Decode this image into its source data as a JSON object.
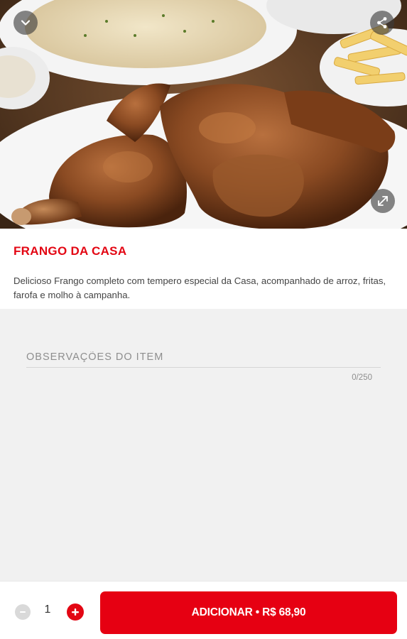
{
  "product": {
    "title": "FRANGO DA CASA",
    "description": "Delicioso Frango completo com tempero especial da Casa, acompanhado de arroz, fritas, farofa e molho à campanha."
  },
  "hero": {
    "back_icon": "chevron-down-icon",
    "share_icon": "share-icon",
    "expand_icon": "expand-icon"
  },
  "observations": {
    "placeholder": "OBSERVAÇÕES DO ITEM",
    "value": "",
    "counter": "0/250"
  },
  "footer": {
    "quantity": "1",
    "add_label": "ADICIONAR • R$ 68,90"
  },
  "colors": {
    "brand_red": "#e30613",
    "background": "#f1f1f1",
    "text": "#444444"
  }
}
